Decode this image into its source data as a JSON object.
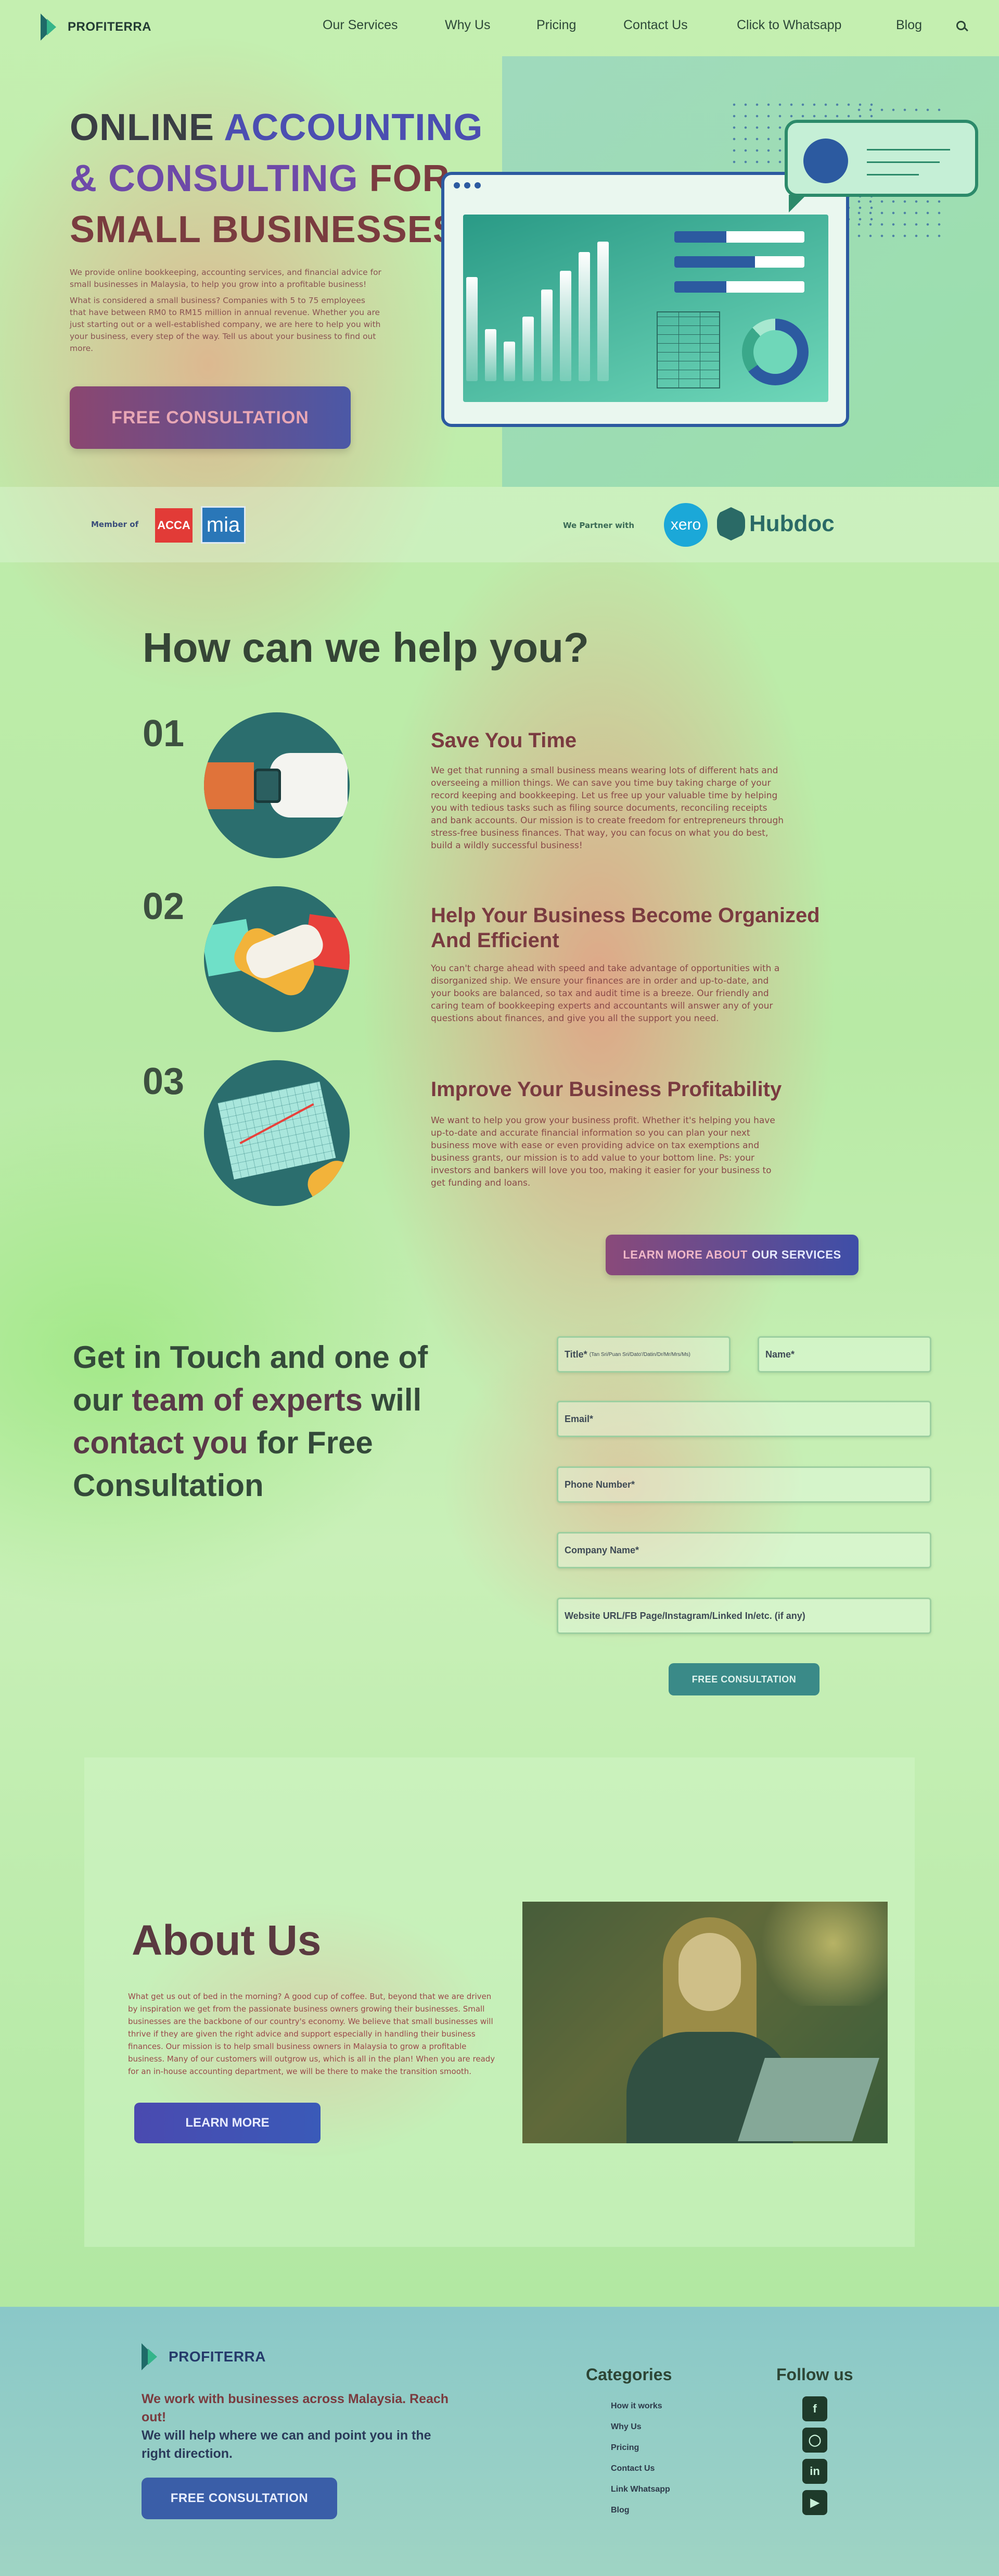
{
  "header": {
    "brand": "PROFITERRA",
    "nav": [
      "Our Services",
      "Why Us",
      "Pricing",
      "Contact Us",
      "Click to Whatsapp",
      "Blog"
    ]
  },
  "hero": {
    "title_word1": "ONLINE",
    "title_word2": "ACCOUNTING",
    "title_word3": "& CONSULTING",
    "title_word4": "FOR",
    "title_word5": "SMALL BUSINESSES",
    "desc1": "We provide online bookkeeping, accounting services, and financial advice for small businesses in Malaysia, to help you grow into a profitable business!",
    "desc2": "What is considered a small business? Companies with 5 to 75 employees that have between RM0 to RM15 million in annual revenue. Whether you are just starting out or a well-established company, we are here to help you with your business, every step of the way. Tell us about your business to find out more.",
    "cta": "FREE CONSULTATION"
  },
  "membership": {
    "member_label": "Member of",
    "acca": "ACCA",
    "mia": "mia",
    "partner_label": "We Partner with",
    "xero": "xero",
    "hubdoc": "Hubdoc"
  },
  "help": {
    "title": "How can we help you?",
    "items": [
      {
        "num": "01",
        "title": "Save You Time",
        "desc": "We get that running a small business means wearing lots of different hats and overseeing a million things. We can save you time buy taking charge of your record keeping and bookkeeping. Let us free up your valuable time by helping you with tedious tasks such as filing source documents, reconciling receipts and bank accounts. Our mission is to create freedom for entrepreneurs through stress-free business finances. That way, you can focus on what you do best, build a wildly successful business!"
      },
      {
        "num": "02",
        "title": "Help Your Business Become Organized And Efficient",
        "desc": "You can't charge ahead with speed and take advantage of opportunities with a disorganized ship. We ensure your finances are in order and up-to-date, and your books are balanced, so tax and audit time is a breeze. Our friendly and caring team of bookkeeping experts and accountants will answer any of your questions about finances, and give you all the support you need."
      },
      {
        "num": "03",
        "title": "Improve Your Business Profitability",
        "desc": "We want to help you grow your business profit. Whether it's helping you have up-to-date and accurate financial information so you can plan your next business move with ease or even providing advice on tax exemptions and business grants, our mission is to add value to your bottom line. Ps: your investors and bankers will love you too, making it easier for your business to get funding and loans."
      }
    ],
    "learn_more_a": "LEARN MORE ABOUT",
    "learn_more_b": "OUR SERVICES"
  },
  "contact": {
    "title_a": "Get in Touch and one of our",
    "title_b": "team of experts",
    "title_c": "will",
    "title_d": "contact you",
    "title_e": "for Free Consultation",
    "fields": {
      "title": "Title*",
      "title_hint": "(Tan Sri/Puan Sri/Dato'/Datin/Dr/Mr/Mrs/Ms)",
      "name": "Name*",
      "email": "Email*",
      "phone": "Phone Number*",
      "company": "Company Name*",
      "website": "Website URL/FB Page/Instagram/Linked In/etc. (if any)"
    },
    "submit": "FREE CONSULTATION"
  },
  "about": {
    "title": "About Us",
    "desc": "What get us out of bed in the morning? A good cup of coffee. But, beyond that we are driven by inspiration we get from the passionate business owners growing their businesses. Small businesses are the backbone of our country's economy. We believe that small businesses will thrive if they are given the right advice and support especially in handling their business finances. Our mission is to help small business owners in Malaysia to grow a profitable business. Many of our customers will outgrow us, which is all in the plan! When you are ready for an in-house accounting department, we will be there to make the transition smooth.",
    "cta": "LEARN MORE"
  },
  "footer": {
    "brand": "PROFITERRA",
    "text1": "We work with businesses across Malaysia. Reach out!",
    "text2": "We will help where we can and point you in the right direction.",
    "cta": "FREE CONSULTATION",
    "categories_title": "Categories",
    "categories": [
      "How it works",
      "Why Us",
      "Pricing",
      "Contact Us",
      "Link Whatsapp",
      "Blog"
    ],
    "follow_title": "Follow us",
    "social": [
      "facebook-icon",
      "instagram-icon",
      "linkedin-icon",
      "youtube-icon"
    ]
  }
}
